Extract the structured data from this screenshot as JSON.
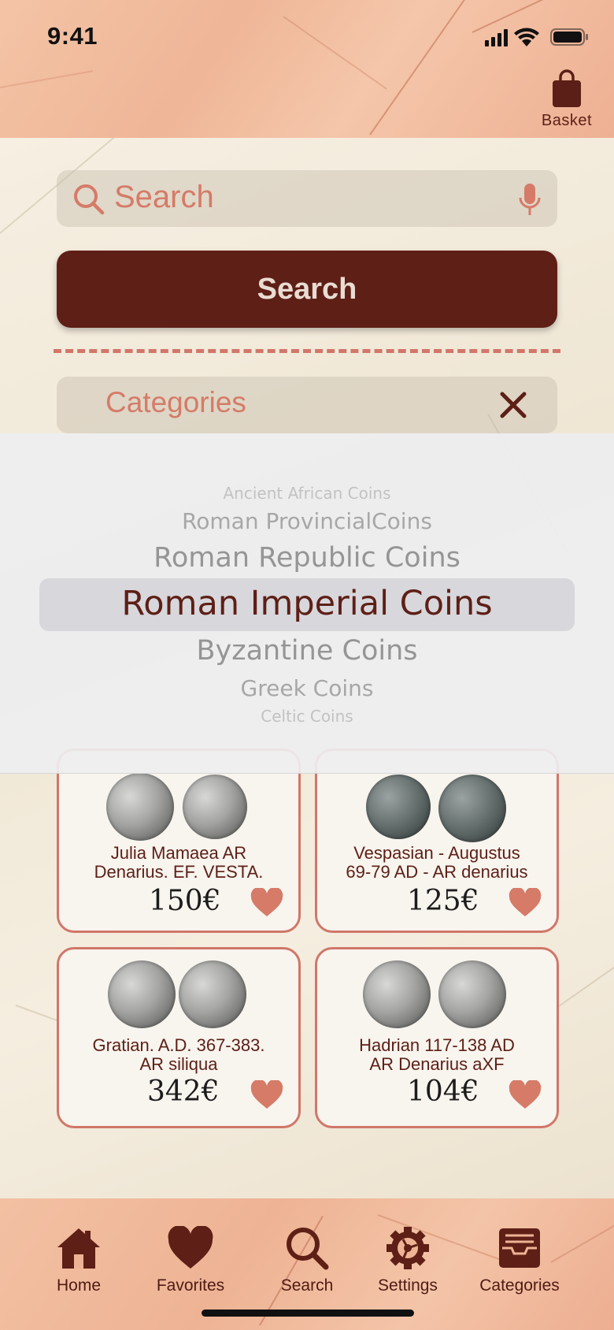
{
  "status": {
    "time": "9:41"
  },
  "header": {
    "basket_label": "Basket"
  },
  "search": {
    "placeholder": "Search",
    "button_label": "Search"
  },
  "categories": {
    "label": "Categories"
  },
  "picker": {
    "options": [
      "Ancient African Coins",
      "Roman ProvincialCoins",
      "Roman Republic Coins",
      "Roman Imperial Coins",
      "Byzantine Coins",
      "Greek Coins",
      "Celtic Coins"
    ],
    "selected": "Roman Imperial Coins"
  },
  "products": [
    {
      "title_line1": "Julia Mamaea AR",
      "title_line2": "Denarius. EF. VESTA.",
      "price": "150€"
    },
    {
      "title_line1": "Vespasian - Augustus",
      "title_line2": "69-79 AD - AR denarius",
      "price": "125€"
    },
    {
      "title_line1": "Gratian. A.D. 367-383.",
      "title_line2": "AR siliqua",
      "price": "342€"
    },
    {
      "title_line1": "Hadrian 117-138 AD",
      "title_line2": "AR Denarius aXF",
      "price": "104€"
    }
  ],
  "tabbar": {
    "items": [
      {
        "label": "Home",
        "icon": "home-icon"
      },
      {
        "label": "Favorites",
        "icon": "heart-icon"
      },
      {
        "label": "Search",
        "icon": "search-icon"
      },
      {
        "label": "Settings",
        "icon": "gear-icon"
      },
      {
        "label": "Categories",
        "icon": "tray-icon"
      }
    ]
  },
  "colors": {
    "accent": "#5e1f16",
    "salmon": "#d57b68",
    "card_border": "#d0776a"
  }
}
